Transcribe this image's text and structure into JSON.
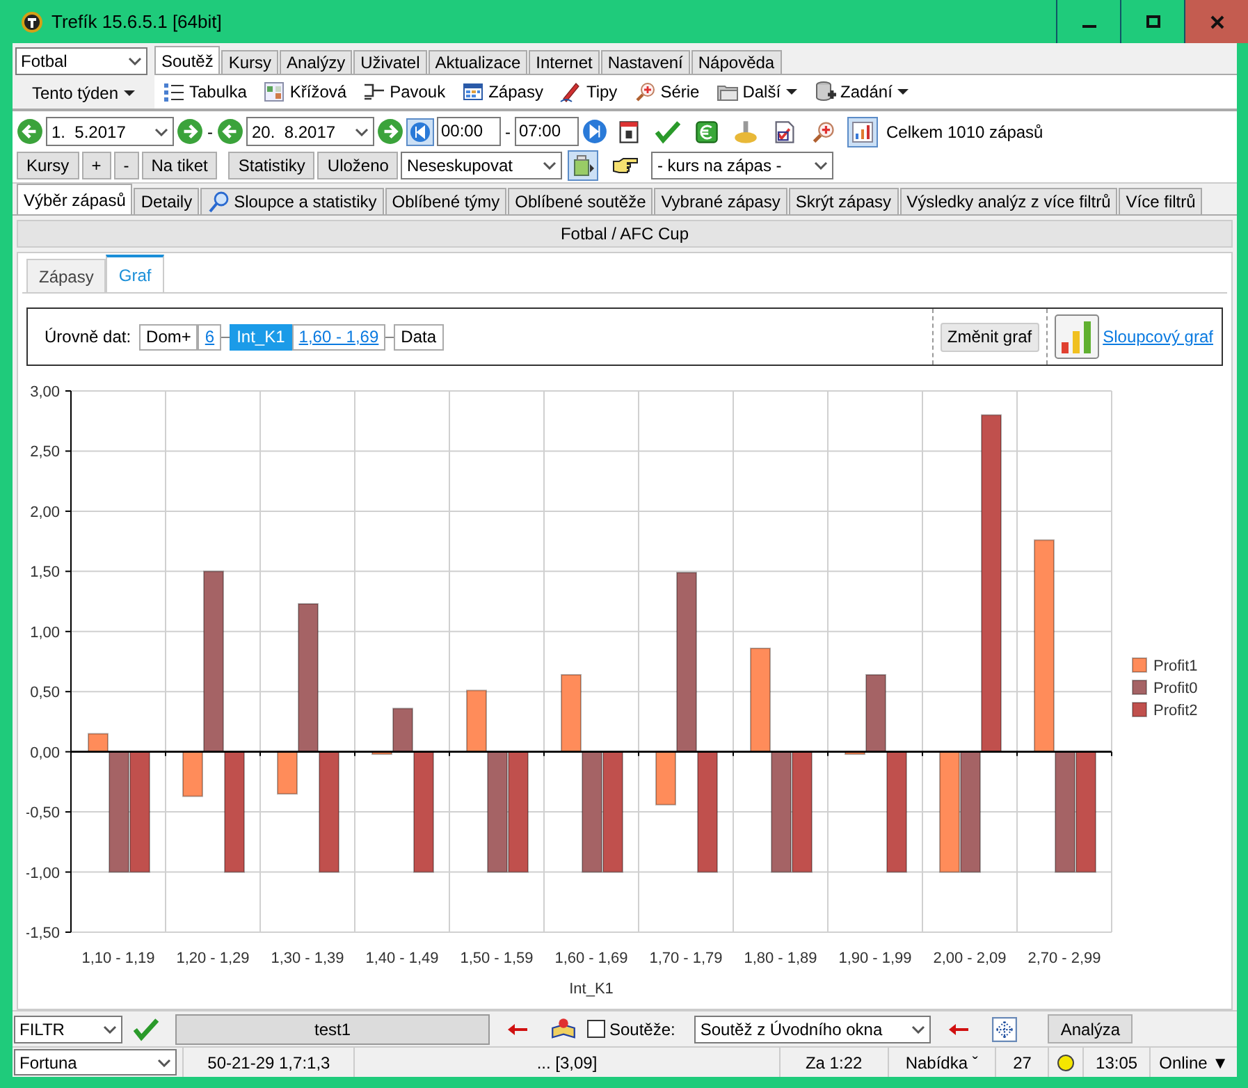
{
  "window": {
    "title": "Trefík 15.6.5.1 [64bit]"
  },
  "sport_select": {
    "value": "Fotbal"
  },
  "period_button": {
    "label": "Tento týden"
  },
  "menu_tabs": [
    {
      "label": "Soutěž",
      "selected": true
    },
    {
      "label": "Kursy",
      "selected": false
    },
    {
      "label": "Analýzy",
      "selected": false
    },
    {
      "label": "Uživatel",
      "selected": false
    },
    {
      "label": "Aktualizace",
      "selected": false
    },
    {
      "label": "Internet",
      "selected": false
    },
    {
      "label": "Nastavení",
      "selected": false
    },
    {
      "label": "Nápověda",
      "selected": false
    }
  ],
  "toolbar": [
    {
      "label": "Tabulka",
      "dropdown": false
    },
    {
      "label": "Křížová",
      "dropdown": false
    },
    {
      "label": "Pavouk",
      "dropdown": false
    },
    {
      "label": "Zápasy",
      "dropdown": false
    },
    {
      "label": "Tipy",
      "dropdown": false
    },
    {
      "label": "Série",
      "dropdown": false
    },
    {
      "label": "Další",
      "dropdown": true
    },
    {
      "label": "Zadání",
      "dropdown": true
    }
  ],
  "date_bar": {
    "date_from": "1.  5.2017",
    "separator": "-",
    "date_to": "20.  8.2017",
    "time_from": "00:00",
    "time_separator": "-",
    "time_to": "07:00",
    "total": "Celkem 1010 zápasů"
  },
  "filter_bar": {
    "buttons": [
      "Kursy",
      "+",
      "-",
      "Na tiket"
    ],
    "buttons2": [
      "Statistiky",
      "Uloženo"
    ],
    "grouping": "Neseskupovat",
    "odds_select": "- kurs na zápas -"
  },
  "tabs": [
    {
      "label": "Výběr zápasů",
      "selected": true
    },
    {
      "label": "Detaily",
      "selected": false
    },
    {
      "label": "Sloupce a statistiky",
      "selected": false
    },
    {
      "label": "Oblíbené týmy",
      "selected": false
    },
    {
      "label": "Oblíbené soutěže",
      "selected": false
    },
    {
      "label": "Vybrané zápasy",
      "selected": false
    },
    {
      "label": "Skrýt zápasy",
      "selected": false
    },
    {
      "label": "Výsledky analýz z více filtrů",
      "selected": false
    },
    {
      "label": "Více filtrů",
      "selected": false
    }
  ],
  "panel": {
    "title": "Fotbal / AFC Cup",
    "view_tabs": [
      {
        "label": "Zápasy",
        "selected": false
      },
      {
        "label": "Graf",
        "selected": true
      }
    ],
    "levels": {
      "label": "Úrovně dat:",
      "items": [
        {
          "text": "Dom+",
          "kind": "text",
          "selected": false
        },
        {
          "text": "6",
          "kind": "link",
          "selected": false
        },
        {
          "text": "Int_K1",
          "kind": "text",
          "selected": true
        },
        {
          "text": "1,60 - 1,69",
          "kind": "link",
          "selected": false
        },
        {
          "text": "Data",
          "kind": "text",
          "selected": false
        }
      ]
    },
    "change_button": "Změnit graf",
    "chart_type_link": "Sloupcový graf"
  },
  "chart": {
    "chart_data": {
      "type": "bar",
      "xlabel": "Int_K1",
      "categories": [
        "1,10 - 1,19",
        "1,20 - 1,29",
        "1,30 - 1,39",
        "1,40 - 1,49",
        "1,50 - 1,59",
        "1,60 - 1,69",
        "1,70 - 1,79",
        "1,80 - 1,89",
        "1,90 - 1,99",
        "2,00 - 2,09",
        "2,70 - 2,99"
      ],
      "series": [
        {
          "name": "Profit1",
          "color": "#ff8c5a",
          "values": [
            0.15,
            -0.37,
            -0.35,
            -0.02,
            0.51,
            0.64,
            -0.44,
            0.86,
            -0.02,
            -1,
            1.76
          ]
        },
        {
          "name": "Profit0",
          "color": "#a56365",
          "values": [
            -1,
            1.5,
            1.23,
            0.36,
            -1,
            -1,
            1.49,
            -1,
            0.64,
            -1,
            -1
          ]
        },
        {
          "name": "Profit2",
          "color": "#c0504d",
          "values": [
            -1,
            -1,
            -1,
            -1,
            -1,
            -1,
            -1,
            -1,
            -1,
            2.8,
            -1
          ]
        }
      ],
      "ylim": [
        -1.5,
        3
      ],
      "grid": true,
      "legend": true,
      "yticks": [
        {
          "value": 3,
          "label": "3,00"
        },
        {
          "value": 2.5,
          "label": "2,50"
        },
        {
          "value": 2,
          "label": "2,00"
        },
        {
          "value": 1.5,
          "label": "1,50"
        },
        {
          "value": 1,
          "label": "1,00"
        },
        {
          "value": 0.5,
          "label": "0,50"
        },
        {
          "value": 0,
          "label": "0,00"
        },
        {
          "value": -0.5,
          "label": "-0,50"
        },
        {
          "value": -1,
          "label": "-1,00"
        },
        {
          "value": -1.5,
          "label": "-1,50"
        }
      ]
    }
  },
  "bottom_bar": {
    "filter_select": "FILTR",
    "filter_name": "test1",
    "competitions_checkbox": {
      "label": "Soutěže:",
      "checked": false
    },
    "competition_select": "Soutěž z Úvodního okna",
    "analyze_button": "Analýza"
  },
  "status_bar": {
    "bookmaker": "Fortuna",
    "cells": [
      "50-21-29  1,7:1,3",
      "... [3,09]",
      "Za 1:22",
      "Nabídka ˇ",
      "27"
    ],
    "time": "13:05",
    "connection": "Online ▼"
  }
}
